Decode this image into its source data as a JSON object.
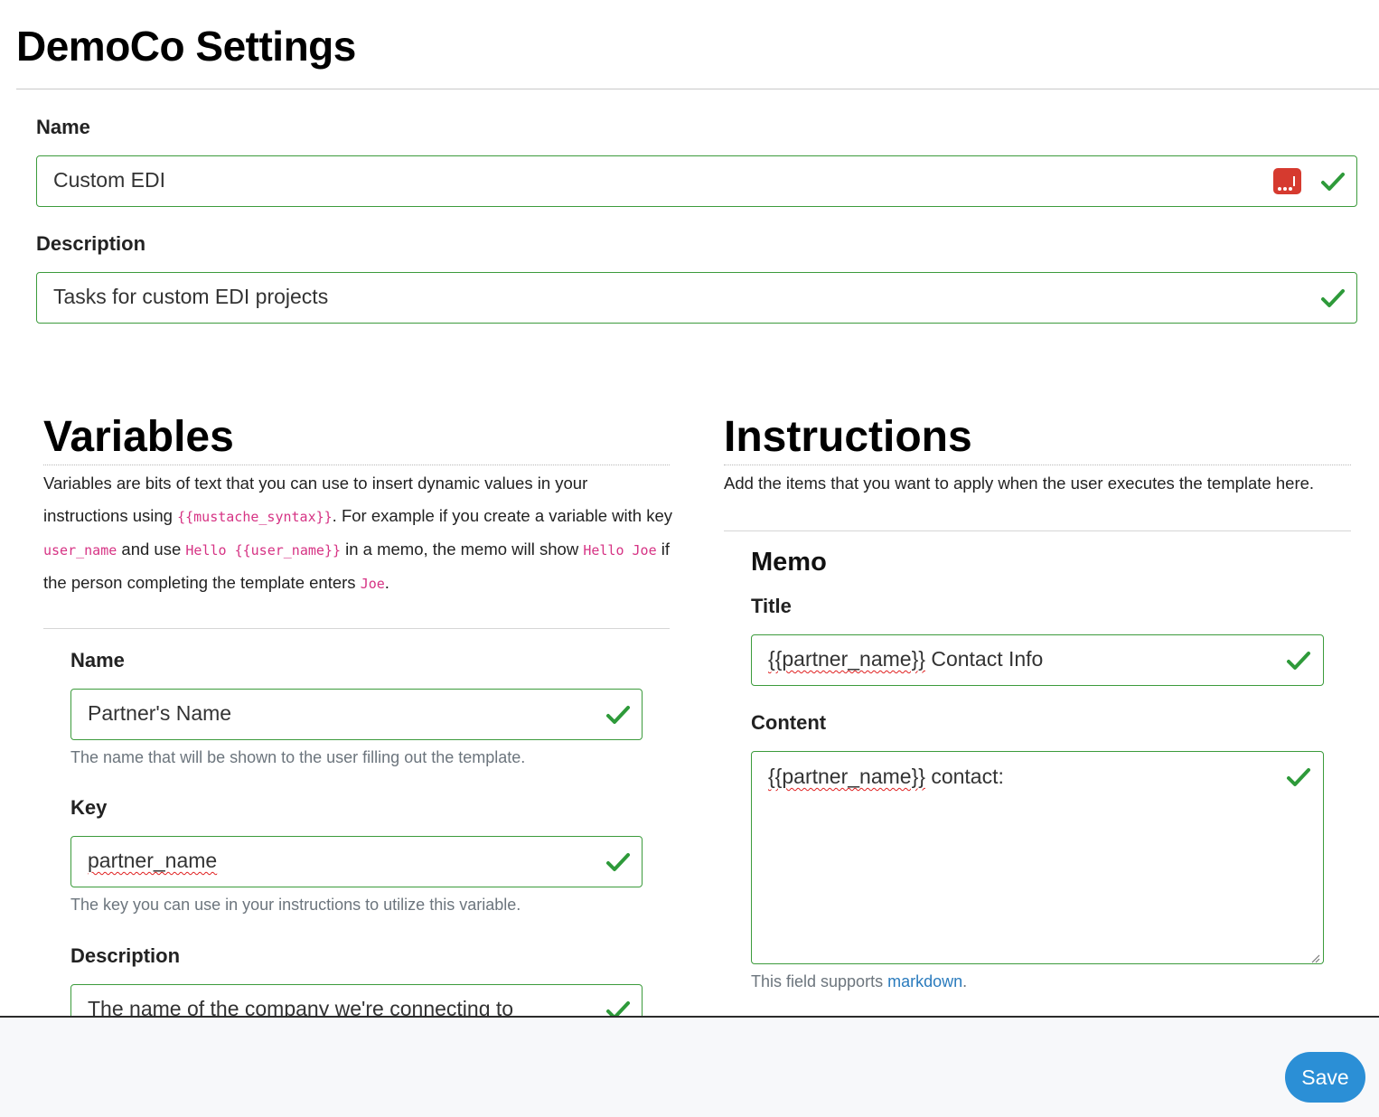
{
  "page": {
    "title": "DemoCo Settings"
  },
  "template": {
    "name_label": "Name",
    "name_value": "Custom EDI",
    "description_label": "Description",
    "description_value": "Tasks for custom EDI projects"
  },
  "variables": {
    "title": "Variables",
    "intro": {
      "t1": "Variables are bits of text that you can use to insert dynamic values in your instructions using ",
      "c1": "{{mustache_syntax}}",
      "t2": ".  For example if you create a variable with key ",
      "c2": "user_name",
      "t3": " and use ",
      "c3": "Hello {{user_name}}",
      "t4": " in a memo, the memo will show ",
      "c4": "Hello Joe",
      "t5": "  if the person completing the template enters ",
      "c5": "Joe",
      "t6": "."
    },
    "item": {
      "name_label": "Name",
      "name_value": "Partner's Name",
      "name_help": "The name that will be shown to the user filling out the template.",
      "key_label": "Key",
      "key_value": "partner_name",
      "key_help": "The key you can use in your instructions to utilize this variable.",
      "description_label": "Description",
      "description_value": "The name of the company we're connecting to"
    }
  },
  "instructions": {
    "title": "Instructions",
    "intro": "Add the items that you want to apply when the user executes the template here.",
    "memo": {
      "heading": "Memo",
      "title_label": "Title",
      "title_var": "{{partner_name}}",
      "title_rest": " Contact Info",
      "content_label": "Content",
      "content_var": "{{partner_name}}",
      "content_rest": " contact:",
      "help_prefix": "This field supports ",
      "help_link": "markdown",
      "help_suffix": "."
    }
  },
  "footer": {
    "save_label": "Save"
  },
  "colors": {
    "valid_border": "#3c9b3c",
    "check": "#2e9a3a",
    "code": "#d63384",
    "link": "#2a7bbd",
    "save_button": "#2b8fd6",
    "password_icon": "#d63a2f"
  },
  "icons": {
    "valid": "check-icon",
    "password_manager": "password-manager-icon",
    "resize": "resize-handle-icon"
  }
}
